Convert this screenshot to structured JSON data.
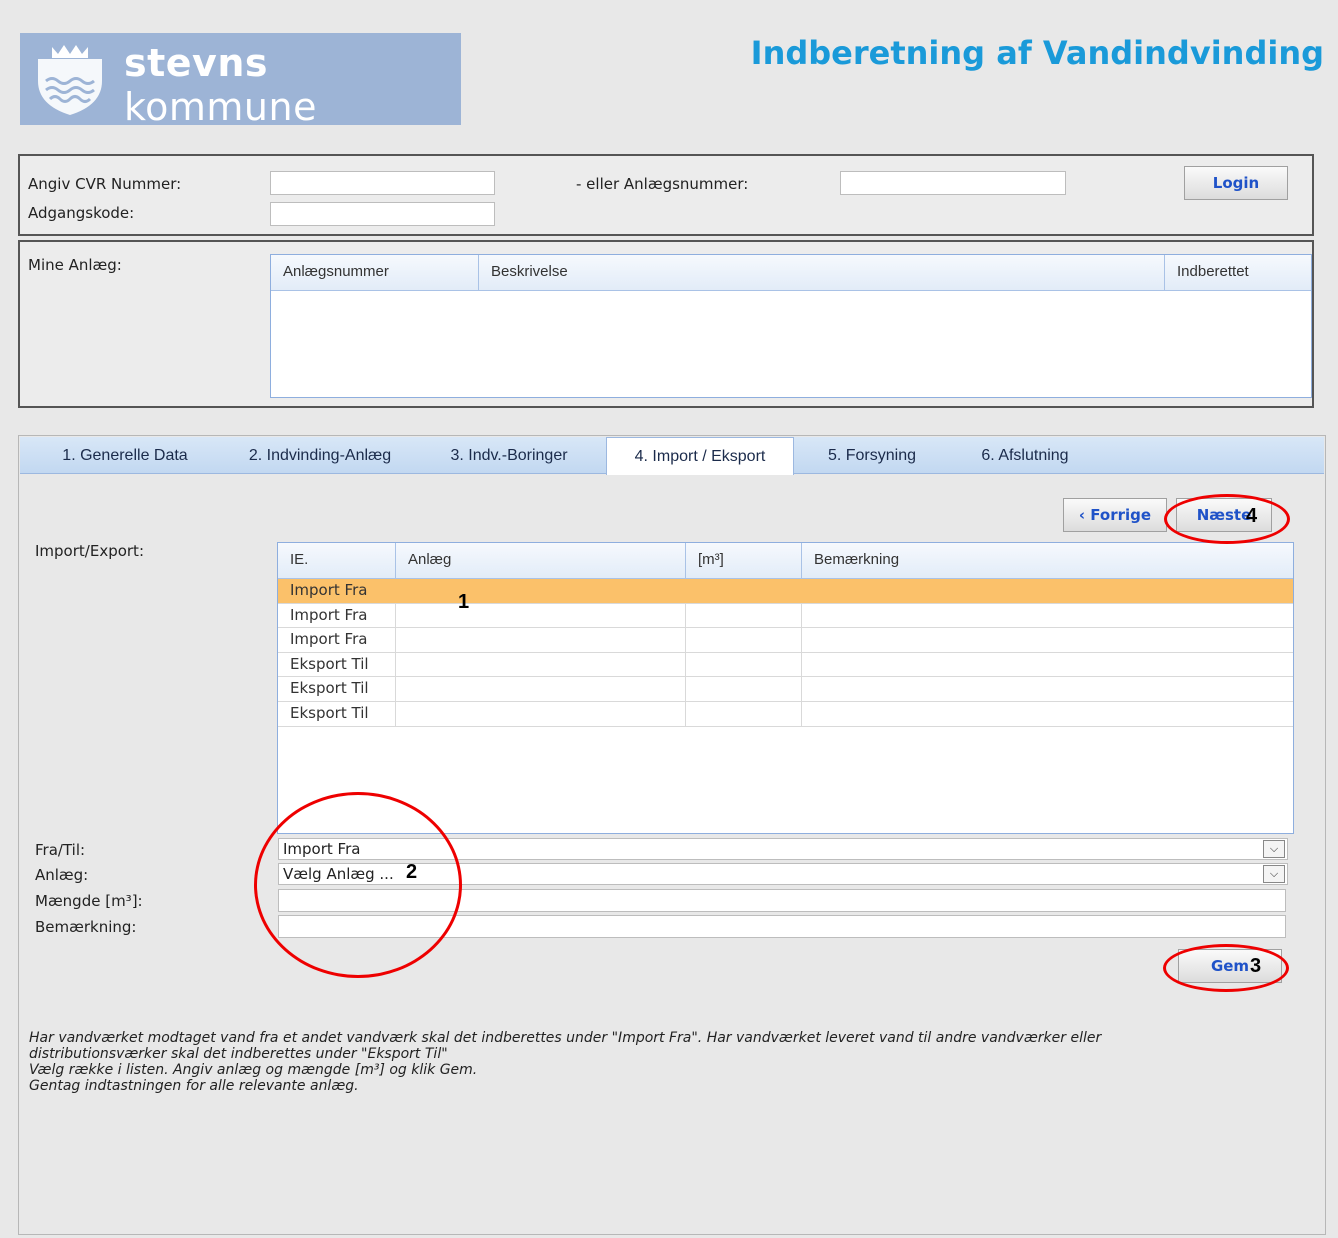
{
  "header": {
    "logo_brand_bold": "stevns",
    "logo_brand_light": "kommune",
    "title": "Indberetning af Vandindvinding"
  },
  "login": {
    "cvr_label": "Angiv CVR Nummer:",
    "password_label": "Adgangskode:",
    "anlaeg_label": "- eller Anlægsnummer:",
    "cvr_value": "",
    "password_value": "",
    "anlaeg_value": "",
    "login_button": "Login"
  },
  "mine_anlaeg": {
    "label": "Mine Anlæg:",
    "columns": [
      "Anlægsnummer",
      "Beskrivelse",
      "Indberettet"
    ]
  },
  "tabs": [
    "1. Generelle Data",
    "2. Indvinding-Anlæg",
    "3. Indv.-Boringer",
    "4. Import / Eksport",
    "5. Forsyning",
    "6. Afslutning"
  ],
  "active_tab": "4. Import / Eksport",
  "nav": {
    "prev": "‹ Forrige",
    "next": "Næste"
  },
  "import_export": {
    "label": "Import/Export:",
    "columns": [
      "IE.",
      "Anlæg",
      "[m³]",
      "Bemærkning"
    ],
    "rows": [
      [
        "Import Fra",
        "",
        "",
        ""
      ],
      [
        "Import Fra",
        "",
        "",
        ""
      ],
      [
        "Import Fra",
        "",
        "",
        ""
      ],
      [
        "Eksport Til",
        "",
        "",
        ""
      ],
      [
        "Eksport Til",
        "",
        "",
        ""
      ],
      [
        "Eksport Til",
        "",
        "",
        ""
      ]
    ]
  },
  "form": {
    "fratil_label": "Fra/Til:",
    "anlaeg_label": "Anlæg:",
    "maengde_label": "Mængde [m³]:",
    "bemaerkning_label": "Bemærkning:",
    "fratil_value": "Import Fra",
    "anlaeg_value": "Vælg Anlæg ...",
    "maengde_value": "",
    "bemaerkning_value": "",
    "save_button": "Gem"
  },
  "help_text": [
    "Har vandværket modtaget vand fra et andet vandværk skal det indberettes under \"Import Fra\". Har vandværket leveret vand til andre vandværker eller",
    "distributionsværker skal det indberettes under \"Eksport Til\"",
    "Vælg række i listen. Angiv anlæg og mængde [m³] og klik Gem.",
    "Gentag indtastningen for alle relevante anlæg."
  ],
  "annotations": {
    "marker_1": "1",
    "marker_2": "2",
    "marker_3": "3",
    "marker_4": "4",
    "color": "#e00000"
  }
}
